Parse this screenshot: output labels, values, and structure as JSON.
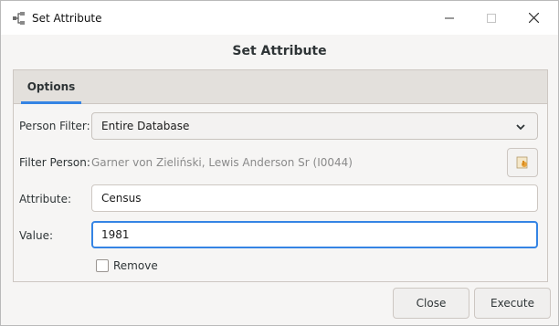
{
  "window": {
    "title": "Set Attribute",
    "app_icon": "gramps-tree-icon",
    "controls": {
      "minimize": "minimize-icon",
      "maximize": "maximize-icon",
      "close": "close-icon"
    }
  },
  "dialog": {
    "header": "Set Attribute",
    "tabs": [
      {
        "label": "Options",
        "selected": true
      }
    ],
    "form": {
      "person_filter": {
        "label": "Person Filter:",
        "value": "Entire Database"
      },
      "filter_person": {
        "label": "Filter Person:",
        "value": "Garner von Zieliński, Lewis Anderson Sr (I0044)"
      },
      "attribute": {
        "label": "Attribute:",
        "value": "Census"
      },
      "value": {
        "label": "Value:",
        "value": "1981"
      },
      "remove": {
        "label": "Remove",
        "checked": false
      }
    },
    "buttons": {
      "close": "Close",
      "execute": "Execute"
    }
  },
  "colors": {
    "accent": "#3584e4",
    "background": "#f6f5f4",
    "tabbar": "#e3e0dc"
  }
}
